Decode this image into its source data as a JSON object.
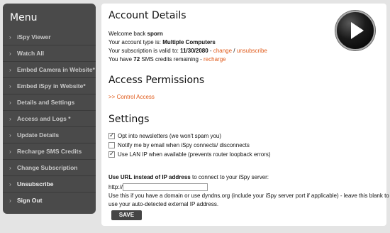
{
  "sidebar": {
    "title": "Menu",
    "items": [
      {
        "label": "iSpy Viewer"
      },
      {
        "label": "Watch All"
      },
      {
        "label": "Embed Camera in Website*"
      },
      {
        "label": "Embed iSpy in Website*"
      },
      {
        "label": "Details and Settings"
      },
      {
        "label": "Access and Logs *"
      },
      {
        "label": "Update Details"
      },
      {
        "label": "Recharge SMS Credits"
      },
      {
        "label": "Change Subscription"
      },
      {
        "label": "Unsubscribe"
      },
      {
        "label": "Sign Out"
      }
    ],
    "chevron": "›"
  },
  "account": {
    "title": "Account Details",
    "welcome_prefix": "Welcome back ",
    "username": "sporn",
    "type_prefix": "Your account type is: ",
    "type_value": "Multiple Computers",
    "valid_prefix": "Your subscription is valid to: ",
    "valid_date": "11/30/2080",
    "valid_sep1": " - ",
    "change_link": "change",
    "valid_sep2": " / ",
    "unsubscribe_link": "unsubscribe",
    "sms_prefix": "You have ",
    "sms_count": "72",
    "sms_suffix": " SMS credits remaining - ",
    "recharge_link": "recharge"
  },
  "access": {
    "title": "Access Permissions",
    "control_link": ">> Control Access"
  },
  "settings": {
    "title": "Settings",
    "options": [
      {
        "label": "Opt into newsletters (we won't spam you)",
        "checked": true
      },
      {
        "label": "Notify me by email when iSpy connects/ disconnects",
        "checked": false
      },
      {
        "label": "Use LAN IP when available (prevents router loopback errors)",
        "checked": true
      }
    ],
    "url_bold": "Use URL instead of IP address",
    "url_rest": " to connect to your iSpy server:",
    "url_prefix": "http://",
    "url_value": "",
    "help_line1": "Use this if you have a domain or use dyndns.org (include your iSpy server port if applicable) - leave this blank to",
    "help_line2": "use your auto-detected external IP address.",
    "save_label": "SAVE"
  },
  "colors": {
    "link": "#e05a1a",
    "sidebar": "#4a4a4a"
  },
  "icons": {
    "play": "play-icon"
  }
}
